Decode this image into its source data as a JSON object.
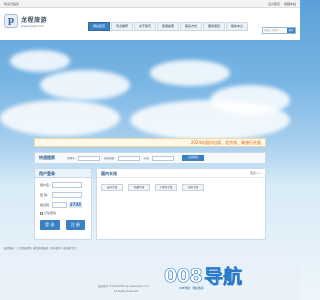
{
  "topbar": {
    "left": "欢迎光临您",
    "links": [
      "设为首页",
      "收藏本站"
    ]
  },
  "logo": {
    "mark": "p",
    "name": "龙程旅游",
    "url": "www.jxjzly.com"
  },
  "nav": {
    "items": [
      "网站首页",
      "景点推荐",
      "关于我们",
      "旅游指南",
      "联系方式",
      "服务项目",
      "留言中心"
    ],
    "active_index": 0
  },
  "search": {
    "placeholder": "请输入关键字",
    "button": "搜索"
  },
  "notice": "2024年国内出境、北京线、青旅行社报",
  "quick_search": {
    "title": "快速搜索",
    "labels": [
      "关键字：",
      "游玩天数：",
      "价格："
    ],
    "button": "立即搜索"
  },
  "login": {
    "title": "用户登录",
    "fields": [
      "用户名：",
      "密  码：",
      "验证码："
    ],
    "captcha": "3735",
    "remember": "记住密码",
    "login_button": "登 录",
    "register_button": "注 册"
  },
  "domestic": {
    "title": "国内长线",
    "more": "更多>>",
    "tags": [
      "云南专线",
      "新疆专线",
      "九寨沟专线",
      "海南专线"
    ]
  },
  "footer": {
    "links": "友情链接：|  江西旅游网  |  赣北旅游集团  |  万年旅游  |  南昌旅行社  |",
    "copy": "版权所有 ©2016-2020 by www.jxjzly.com",
    "copy2": "All Rights Reserved"
  },
  "watermark": {
    "logo": "008",
    "text": "导航",
    "sub": "008导航 · 网址收录"
  },
  "colors": {
    "accent": "#3b7fc4",
    "notice_text": "#d8620a"
  }
}
